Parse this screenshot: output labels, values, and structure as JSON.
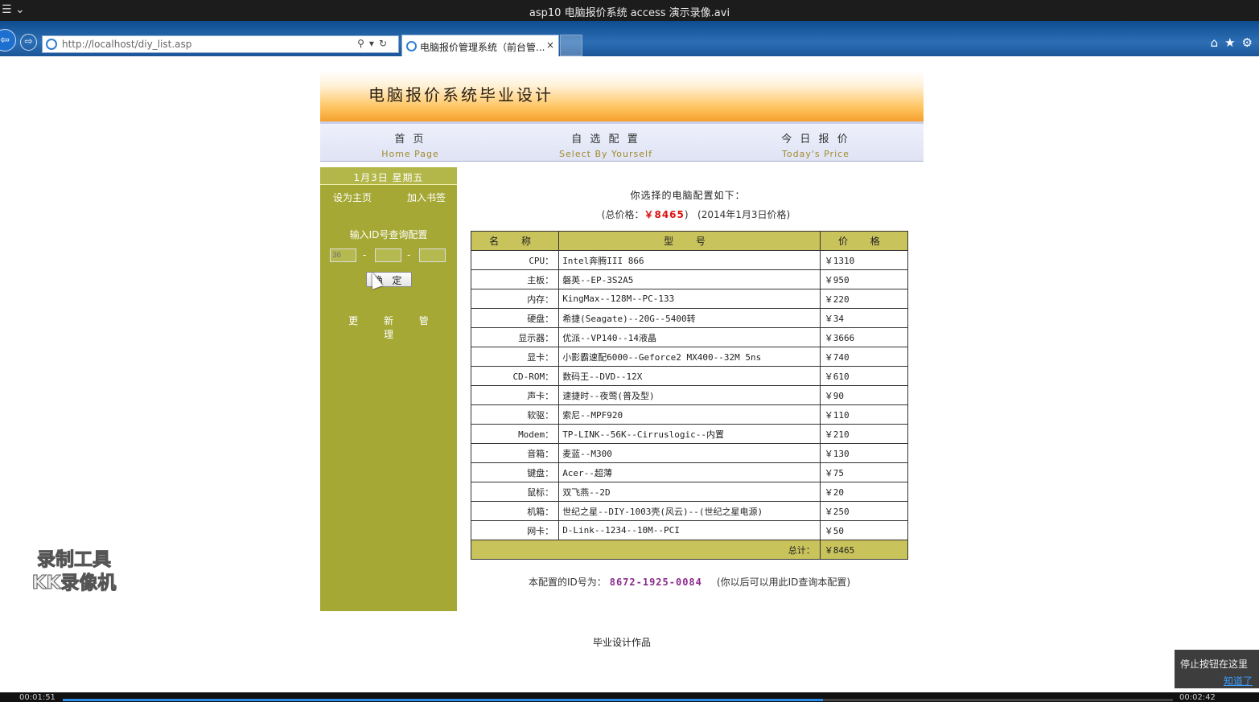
{
  "window": {
    "title": "asp10 电脑报价系统 access 演示录像.avi"
  },
  "browser": {
    "address": "http://localhost/diy_list.asp",
    "tab_title": "电脑报价管理系统（前台管...",
    "tab_close": "×"
  },
  "site": {
    "banner_title": "电脑报价系统毕业设计",
    "nav": [
      {
        "cn": "首 页",
        "en": "Home Page"
      },
      {
        "cn": "自 选 配 置",
        "en": "Select By Yourself"
      },
      {
        "cn": "今 日 报 价",
        "en": "Today's Price"
      }
    ]
  },
  "sidebar": {
    "date": "1月3日 星期五",
    "set_home": "设为主页",
    "bookmark": "加入书签",
    "query_label": "输入ID号查询配置",
    "query_placeholder_1": "36",
    "query_placeholder_2": "",
    "query_placeholder_3": "",
    "dash": "-",
    "confirm": "确 定",
    "update": "更 新 管 理"
  },
  "summary": {
    "heading": "你选择的电脑配置如下：",
    "total_prefix": "(总价格：",
    "total_value": "￥8465",
    "total_suffix": ")",
    "price_date": "(2014年1月3日价格)"
  },
  "table": {
    "headers": [
      "名 称",
      "型 号",
      "价 格"
    ],
    "rows": [
      {
        "name": "CPU：",
        "model": "Intel奔腾III 866",
        "price": "￥1310"
      },
      {
        "name": "主板：",
        "model": "磐英--EP-3S2A5",
        "price": "￥950"
      },
      {
        "name": "内存：",
        "model": "KingMax--128M--PC-133",
        "price": "￥220"
      },
      {
        "name": "硬盘：",
        "model": "希捷(Seagate)--20G--5400转",
        "price": "￥34"
      },
      {
        "name": "显示器：",
        "model": "优派--VP140--14液晶",
        "price": "￥3666"
      },
      {
        "name": "显卡：",
        "model": "小影霸速配6000--Geforce2 MX400--32M 5ns",
        "price": "￥740"
      },
      {
        "name": "CD-ROM：",
        "model": "数码王--DVD--12X",
        "price": "￥610"
      },
      {
        "name": "声卡：",
        "model": "速捷时--夜莺(普及型)",
        "price": "￥90"
      },
      {
        "name": "软驱：",
        "model": "索尼--MPF920",
        "price": "￥110"
      },
      {
        "name": "Modem：",
        "model": "TP-LINK--56K--Cirruslogic--内置",
        "price": "￥210"
      },
      {
        "name": "音箱：",
        "model": "麦蓝--M300",
        "price": "￥130"
      },
      {
        "name": "键盘：",
        "model": "Acer--超薄",
        "price": "￥75"
      },
      {
        "name": "鼠标：",
        "model": "双飞燕--2D",
        "price": "￥20"
      },
      {
        "name": "机箱：",
        "model": "世纪之星--DIY-1003壳(风云)--(世纪之星电源)",
        "price": "￥250"
      },
      {
        "name": "网卡：",
        "model": "D-Link--1234--10M--PCI",
        "price": "￥50"
      }
    ],
    "total_label": "总计：",
    "total_value": "￥8465"
  },
  "config_id": {
    "label": "本配置的ID号为：",
    "value": "8672-1925-0084",
    "note": "(你以后可以用此ID查询本配置)"
  },
  "footer": "毕业设计作品",
  "overlay": {
    "watermark_line1": "录制工具",
    "watermark_line2": "KK录像机",
    "tip": "停止按钮在这里",
    "tip_link": "知道了",
    "time_elapsed": "00:01:51",
    "time_total": "00:02:42",
    "progress_fraction": 0.685
  }
}
